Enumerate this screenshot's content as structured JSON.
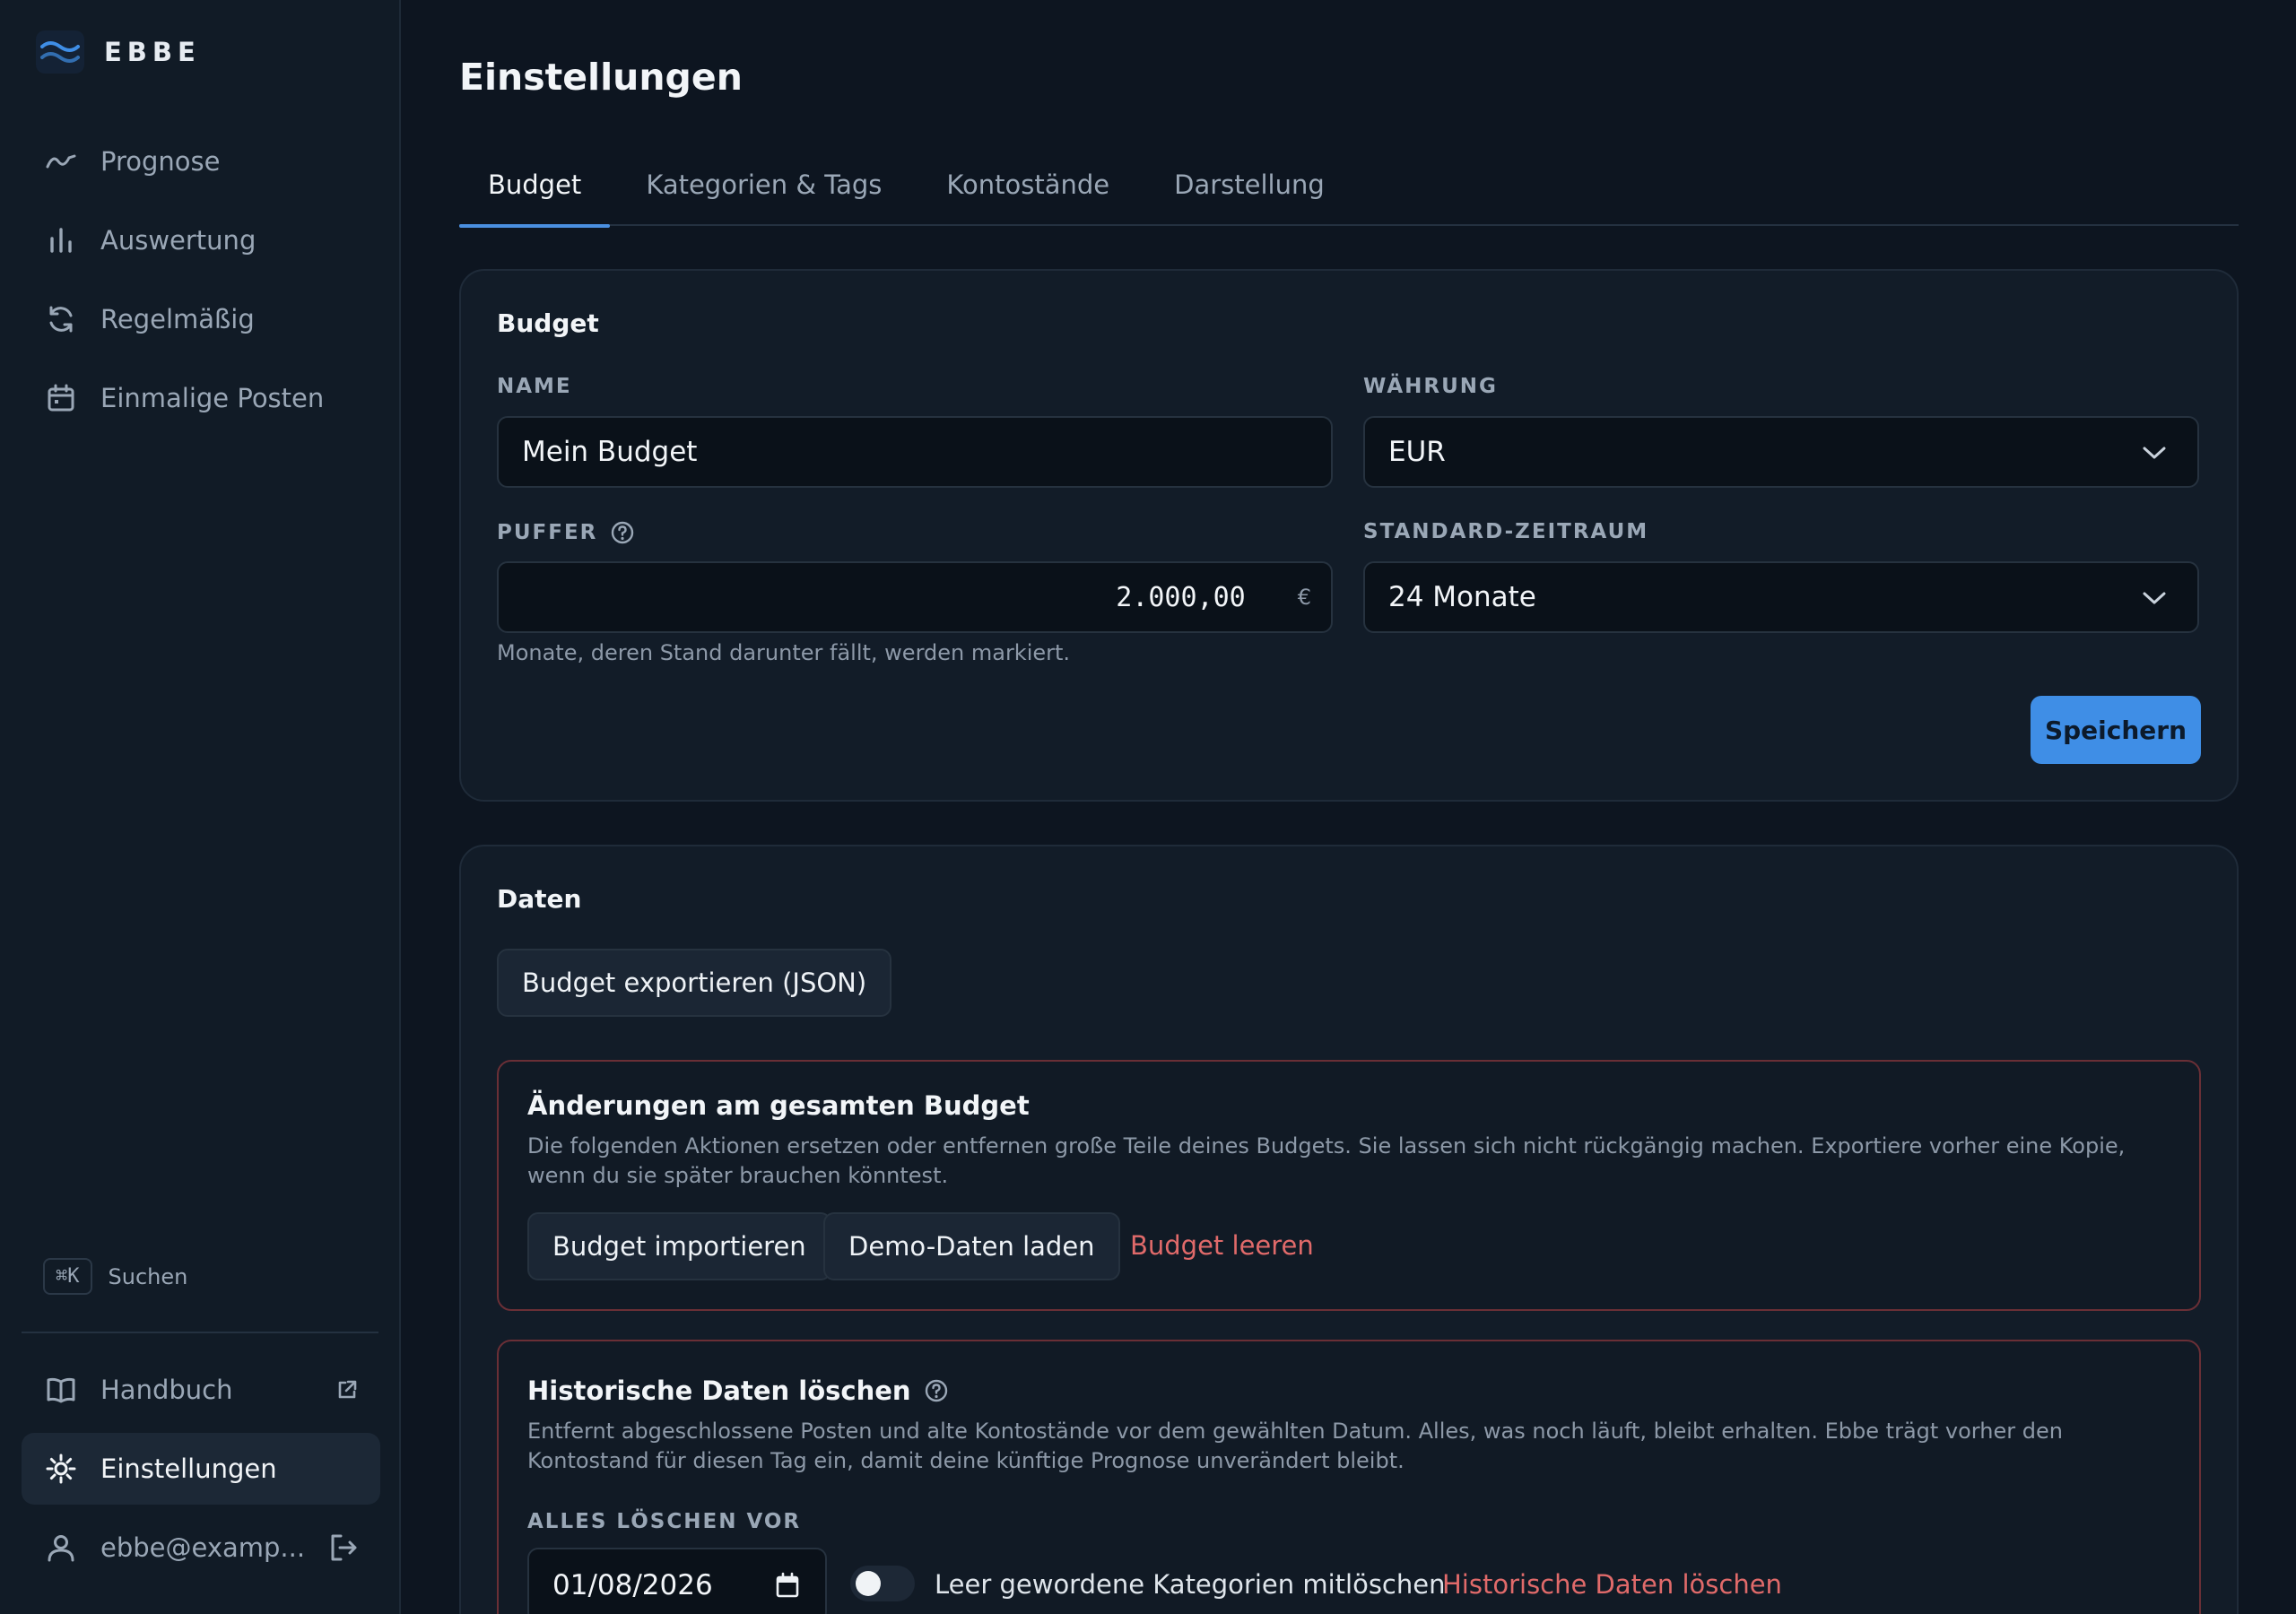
{
  "app": {
    "name": "EBBE"
  },
  "sidebar": {
    "items": [
      {
        "label": "Prognose",
        "icon": "trend-icon"
      },
      {
        "label": "Auswertung",
        "icon": "bar-chart-icon"
      },
      {
        "label": "Regelmäßig",
        "icon": "refresh-icon"
      },
      {
        "label": "Einmalige Posten",
        "icon": "calendar-icon"
      }
    ],
    "search": {
      "shortcut": "⌘K",
      "label": "Suchen"
    },
    "bottom": {
      "manual": "Handbuch",
      "settings": "Einstellungen",
      "user": "ebbe@examp..."
    }
  },
  "page": {
    "title": "Einstellungen"
  },
  "tabs": [
    "Budget",
    "Kategorien & Tags",
    "Kontostände",
    "Darstellung"
  ],
  "budget_card": {
    "title": "Budget",
    "name_label": "NAME",
    "name_value": "Mein Budget",
    "currency_label": "WÄHRUNG",
    "currency_value": "EUR",
    "buffer_label": "PUFFER",
    "buffer_value": "2.000,00",
    "buffer_unit": "€",
    "buffer_help": "Monate, deren Stand darunter fällt, werden markiert.",
    "period_label": "STANDARD-ZEITRAUM",
    "period_value": "24 Monate",
    "save_label": "Speichern"
  },
  "data_card": {
    "title": "Daten",
    "export_label": "Budget exportieren (JSON)",
    "whole_budget": {
      "title": "Änderungen am gesamten Budget",
      "text": "Die folgenden Aktionen ersetzen oder entfernen große Teile deines Budgets. Sie lassen sich nicht rückgängig machen. Exportiere vorher eine Kopie, wenn du sie später brauchen könntest.",
      "import_label": "Budget importieren",
      "demo_label": "Demo-Daten laden",
      "clear_label": "Budget leeren"
    },
    "history": {
      "title": "Historische Daten löschen",
      "text": "Entfernt abgeschlossene Posten und alte Kontostände vor dem gewählten Datum. Alles, was noch läuft, bleibt erhalten. Ebbe trägt vorher den Kontostand für diesen Tag ein, damit deine künftige Prognose unverändert bleibt.",
      "date_label": "ALLES LÖSCHEN VOR",
      "date_value": "01/08/2026",
      "toggle_label": "Leer gewordene Kategorien mitlöschen",
      "toggle_on": false,
      "delete_label": "Historische Daten löschen"
    }
  },
  "colors": {
    "accent": "#3f8ee6",
    "danger": "#e06a6a",
    "background": "#0d1520"
  }
}
